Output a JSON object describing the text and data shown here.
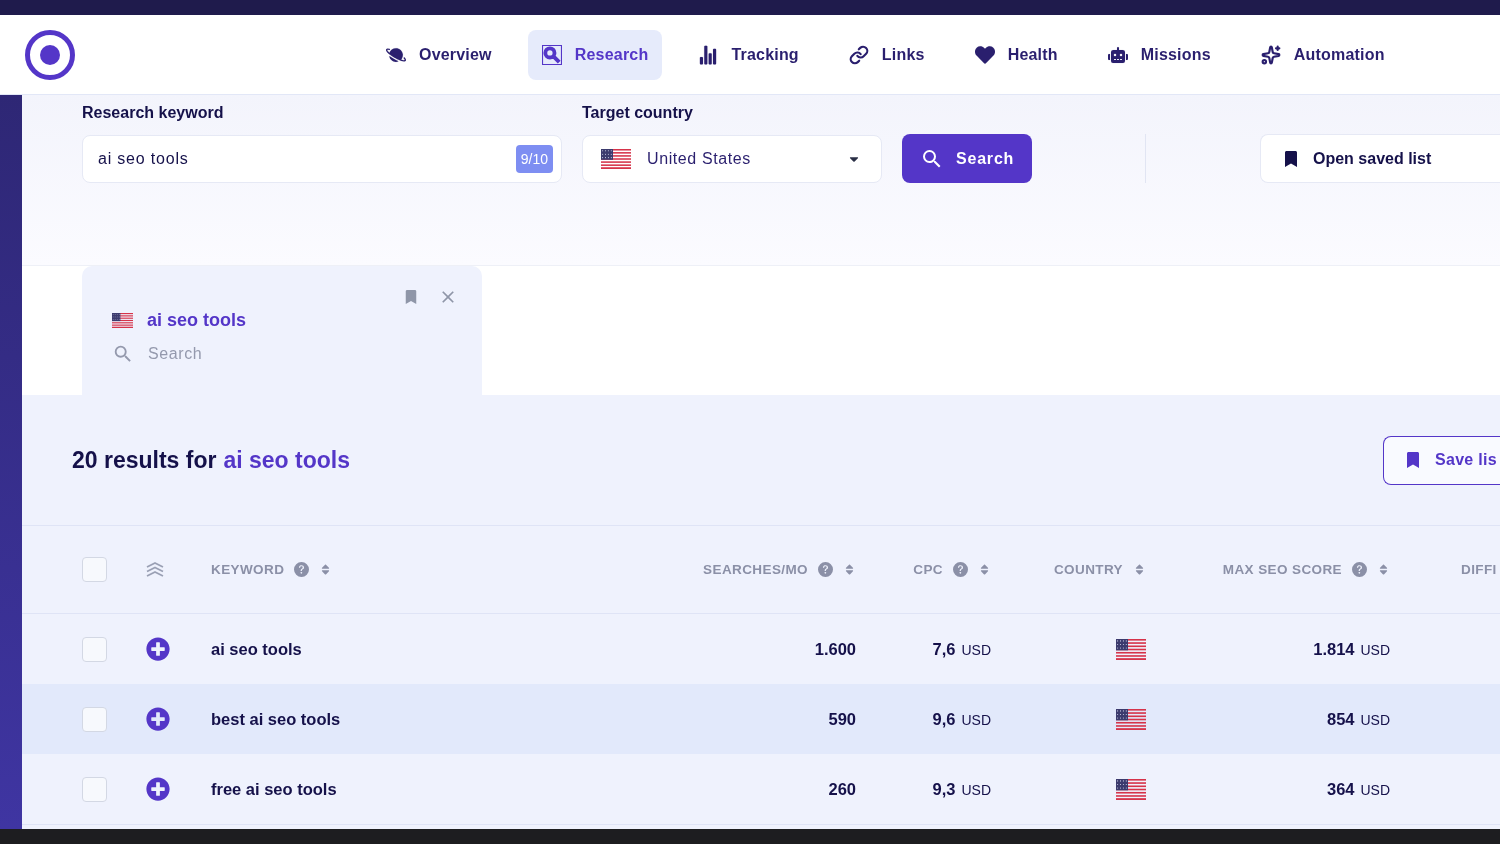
{
  "header": {
    "nav": [
      {
        "label": "Overview",
        "selected": false
      },
      {
        "label": "Research",
        "selected": true
      },
      {
        "label": "Tracking",
        "selected": false
      },
      {
        "label": "Links",
        "selected": false
      },
      {
        "label": "Health",
        "selected": false
      },
      {
        "label": "Missions",
        "selected": false
      },
      {
        "label": "Automation",
        "selected": false
      }
    ]
  },
  "search_form": {
    "keyword": {
      "label": "Research keyword",
      "value": "ai seo tools",
      "count": "9/10"
    },
    "country": {
      "label": "Target country",
      "value": "United States"
    },
    "search_button": "Search",
    "open_saved_list_button": "Open saved list"
  },
  "history": [
    {
      "keyword": "ai seo tools",
      "type": "Search",
      "selected": true
    }
  ],
  "results": {
    "count_text": "20 results for",
    "query": "ai seo tools",
    "save_button": "Save lis",
    "table": {
      "select_all": {
        "checked": false
      },
      "columns": [
        {
          "label": "KEYWORD",
          "help": true,
          "sortable": true
        },
        {
          "label": "SEARCHES/MO",
          "help": true,
          "sortable": true
        },
        {
          "label": "CPC",
          "help": true,
          "sortable": true
        },
        {
          "label": "COUNTRY",
          "help": false,
          "sortable": true
        },
        {
          "label": "MAX SEO SCORE",
          "help": true,
          "sortable": true
        },
        {
          "label": "DIFFI"
        }
      ],
      "rows": [
        {
          "checked": false,
          "highlighted": false,
          "keyword": "ai seo tools",
          "searches": "1.600",
          "cpc": "**7,6** USD",
          "max_seo_score": "**1.814** USD"
        },
        {
          "checked": false,
          "highlighted": true,
          "keyword": "best ai seo tools",
          "searches": "590",
          "cpc": "**9,6** USD",
          "max_seo_score": "**854** USD"
        },
        {
          "checked": false,
          "highlighted": false,
          "keyword": "free ai seo tools",
          "searches": "260",
          "cpc": "**9,3** USD",
          "max_seo_score": "**364** USD"
        }
      ]
    }
  }
}
